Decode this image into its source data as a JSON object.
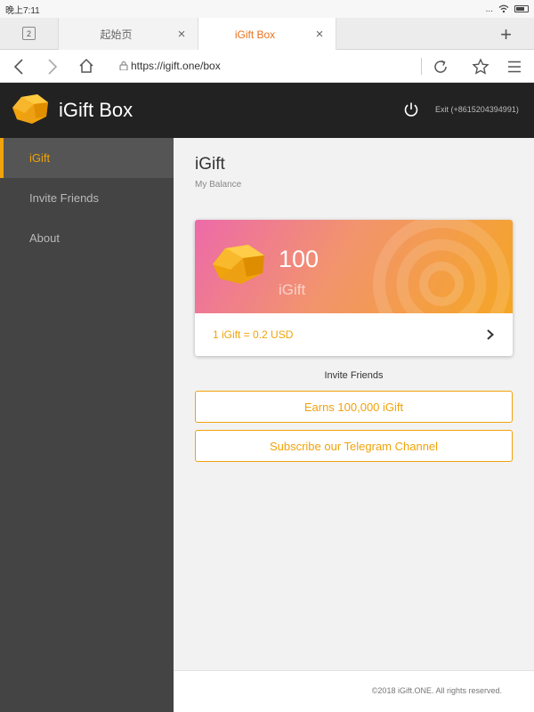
{
  "status_bar": {
    "time": "晚上7:11",
    "signal": "...",
    "wifi": "wifi-icon"
  },
  "browser": {
    "tab_count": "2",
    "tabs": [
      {
        "title": "起始页",
        "active": false
      },
      {
        "title": "iGift Box",
        "active": true
      }
    ],
    "close_glyph": "×",
    "new_tab_glyph": "+",
    "url": "https://igift.one/box"
  },
  "header": {
    "title": "iGift Box",
    "exit_text": "Exit (+8615204394991)"
  },
  "sidebar": {
    "items": [
      {
        "label": "iGift",
        "active": true
      },
      {
        "label": "Invite Friends",
        "active": false
      },
      {
        "label": "About",
        "active": false
      }
    ]
  },
  "main": {
    "title": "iGift",
    "subtitle": "My Balance",
    "balance": {
      "value": "100",
      "unit": "iGift",
      "rate": "1 iGift = 0.2 USD"
    },
    "invite_label": "Invite Friends",
    "earn_button": "Earns 100,000 iGift",
    "telegram_button": "Subscribe our Telegram Channel",
    "footer": "©2018 iGift.ONE. All rights reserved."
  },
  "colors": {
    "accent": "#f0a30a",
    "header_bg": "#222222",
    "sidebar_bg": "#444444",
    "active_tab_text": "#e8711c"
  }
}
